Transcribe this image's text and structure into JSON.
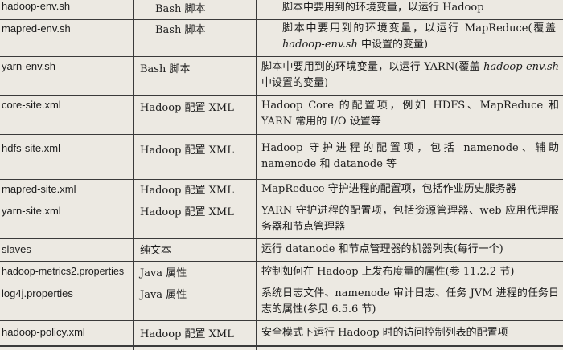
{
  "rows": [
    {
      "file": "hadoop-env.sh",
      "format": "Bash 脚本",
      "desc": "脚本中要用到的环境变量，以运行 Hadoop"
    },
    {
      "file": "mapred-env.sh",
      "format": "Bash 脚本",
      "desc_pre": "脚本中要用到的环境变量，以运行 MapReduce(覆盖 ",
      "desc_em": "hadoop-env.sh",
      "desc_post": " 中设置的变量)"
    },
    {
      "file": "yarn-env.sh",
      "format": "Bash 脚本",
      "desc_pre": "脚本中要用到的环境变量，以运行 YARN(覆盖 ",
      "desc_em": "hadoop-env.sh",
      "desc_post": " 中设置的变量)"
    },
    {
      "file": "core-site.xml",
      "format": "Hadoop 配置 XML",
      "desc": "Hadoop Core 的配置项，例如 HDFS、MapReduce 和 YARN 常用的 I/O 设置等"
    },
    {
      "file": "hdfs-site.xml",
      "format": "Hadoop 配置 XML",
      "desc": "Hadoop 守护进程的配置项，包括 namenode、辅助 namenode 和 datanode 等"
    },
    {
      "file": "mapred-site.xml",
      "format": "Hadoop 配置 XML",
      "desc": "MapReduce 守护进程的配置项，包括作业历史服务器"
    },
    {
      "file": "yarn-site.xml",
      "format": "Hadoop 配置 XML",
      "desc": "YARN 守护进程的配置项，包括资源管理器、web 应用代理服务器和节点管理器"
    },
    {
      "file": "slaves",
      "format": "纯文本",
      "desc": "运行 datanode 和节点管理器的机器列表(每行一个)"
    },
    {
      "file": "hadoop-metrics2.properties",
      "format": "Java 属性",
      "desc": "控制如何在 Hadoop 上发布度量的属性(参 11.2.2 节)"
    },
    {
      "file": "log4j.properties",
      "format": "Java 属性",
      "desc": "系统日志文件、namenode 审计日志、任务 JVM 进程的任务日志的属性(参见 6.5.6 节)"
    },
    {
      "file": "hadoop-policy.xml",
      "format": "Hadoop 配置 XML",
      "desc": "安全模式下运行 Hadoop 时的访问控制列表的配置项"
    }
  ]
}
